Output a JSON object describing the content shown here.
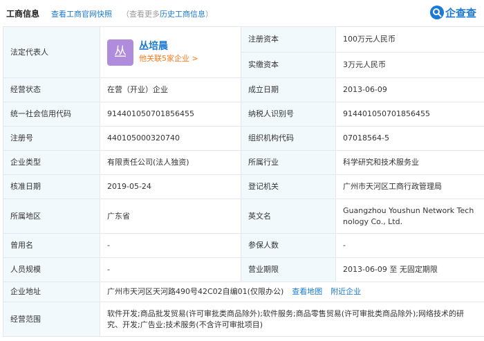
{
  "header": {
    "title": "工商信息",
    "snapshot_link": "查看工商官网快照",
    "more_prefix": "（查看更多",
    "more_link": "历史工商信息",
    "more_suffix": "）",
    "logo_text": "企查查"
  },
  "legal_rep": {
    "label": "法定代表人",
    "avatar_char": "丛",
    "name": "丛培晨",
    "assoc": "他关联5家企业 >"
  },
  "rows": {
    "reg_capital": {
      "label": "注册资本",
      "value": "100万元人民币"
    },
    "paid_capital": {
      "label": "实缴资本",
      "value": "3万元人民币"
    },
    "status": {
      "label": "经营状态",
      "value": "在营（开业）企业"
    },
    "established": {
      "label": "成立日期",
      "value": "2013-06-09"
    },
    "credit_code": {
      "label": "统一社会信用代码",
      "value": "914401050701856455"
    },
    "taxpayer_id": {
      "label": "纳税人识别号",
      "value": "914401050701856455"
    },
    "reg_no": {
      "label": "注册号",
      "value": "440105000320740"
    },
    "org_code": {
      "label": "组织机构代码",
      "value": "07018564-5"
    },
    "company_type": {
      "label": "企业类型",
      "value": "有限责任公司(法人独资)"
    },
    "industry": {
      "label": "所属行业",
      "value": "科学研究和技术服务业"
    },
    "approval_date": {
      "label": "核准日期",
      "value": "2019-05-24"
    },
    "authority": {
      "label": "登记机关",
      "value": "广州市天河区工商行政管理局"
    },
    "region": {
      "label": "所属地区",
      "value": "广东省"
    },
    "english_name": {
      "label": "英文名",
      "value": "Guangzhou Youshun Network Technology Co., Ltd."
    },
    "former_name": {
      "label": "曾用名",
      "value": "-"
    },
    "insured": {
      "label": "参保人数",
      "value": "-"
    },
    "staff_size": {
      "label": "人员规模",
      "value": "-"
    },
    "term": {
      "label": "营业期限",
      "value": "2013-06-09 至 无固定期限"
    },
    "address": {
      "label": "企业地址",
      "value": "广州市天河区天河路490号42C02自编01(仅限办公)",
      "map_link": "查看地图",
      "nearby_link": "附近企业"
    },
    "scope": {
      "label": "经营范围",
      "value": "软件开发;商品批发贸易(许可审批类商品除外);软件服务;商品零售贸易(许可审批类商品除外);网络技术的研究、开发;广告业;技术服务(不含许可审批项目)"
    }
  },
  "colors": {
    "accent": "#1b7ad3",
    "label_bg": "#f2f9fc",
    "border": "#e4e8ee",
    "assoc": "#ff7a1a",
    "avatar_bg": "#b08cdc"
  }
}
